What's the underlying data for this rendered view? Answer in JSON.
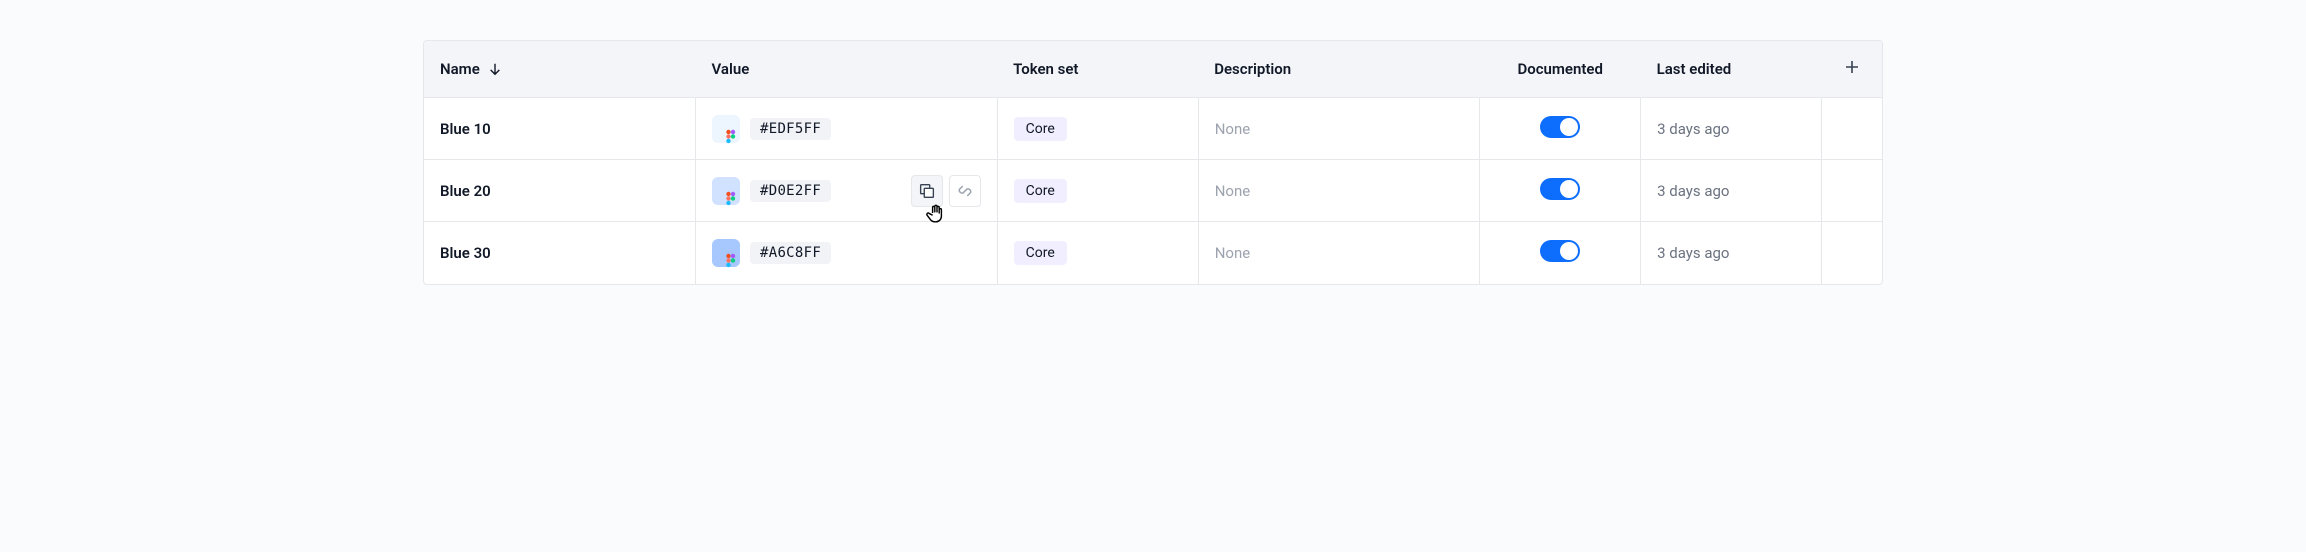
{
  "columns": {
    "name": "Name",
    "value": "Value",
    "token_set": "Token set",
    "description": "Description",
    "documented": "Documented",
    "last_edited": "Last edited"
  },
  "rows": [
    {
      "name": "Blue 10",
      "swatch": "#EDF5FF",
      "hex": "#EDF5FF",
      "token_set": "Core",
      "description": "None",
      "documented": true,
      "last_edited": "3 days ago",
      "show_actions": false
    },
    {
      "name": "Blue 20",
      "swatch": "#D0E2FF",
      "hex": "#D0E2FF",
      "token_set": "Core",
      "description": "None",
      "documented": true,
      "last_edited": "3 days ago",
      "show_actions": true
    },
    {
      "name": "Blue 30",
      "swatch": "#A6C8FF",
      "hex": "#A6C8FF",
      "token_set": "Core",
      "description": "None",
      "documented": true,
      "last_edited": "3 days ago",
      "show_actions": false
    }
  ],
  "icons": {
    "copy": "copy-icon",
    "link": "link-icon"
  }
}
